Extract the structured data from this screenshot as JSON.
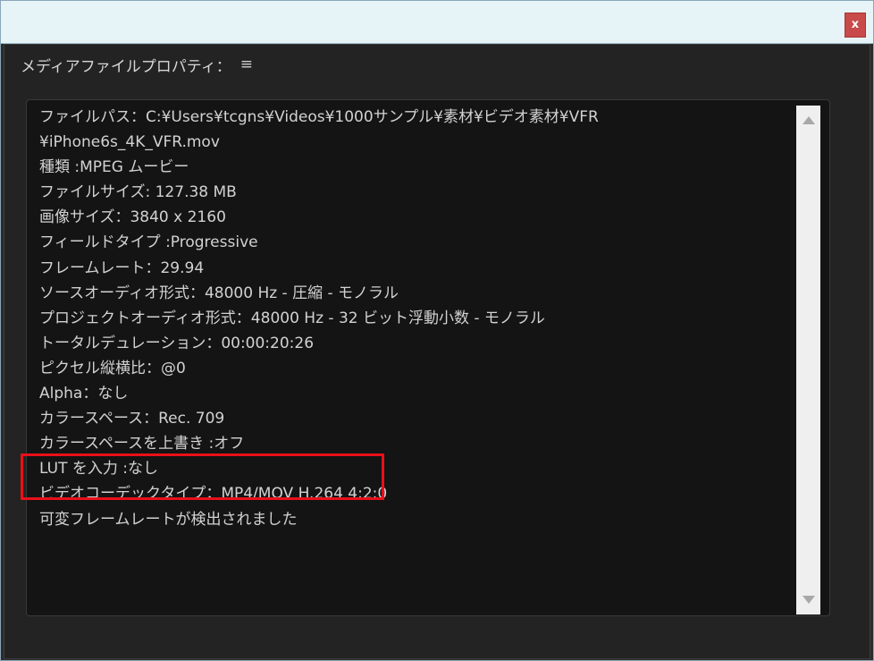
{
  "window": {
    "close_label": "x"
  },
  "panel": {
    "title": "メディアファイルプロパティ：",
    "menu_icon": "hamburger-menu-icon",
    "menu_glyph": "≡"
  },
  "properties": [
    "ファイルパス：C:¥Users¥tcgns¥Videos¥1000サンプル¥素材¥ビデオ素材¥VFR",
    "¥iPhone6s_4K_VFR.mov",
    "種類 :MPEG ムービー",
    "ファイルサイズ: 127.38 MB",
    "画像サイズ：3840 x 2160",
    "フィールドタイプ :Progressive",
    "フレームレート：29.94",
    "ソースオーディオ形式：48000 Hz - 圧縮 - モノラル",
    "プロジェクトオーディオ形式：48000 Hz - 32 ビット浮動小数 - モノラル",
    "トータルデュレーション：00:00:20:26",
    "ピクセル縦横比：@0",
    "Alpha：なし",
    "カラースペース：Rec. 709",
    "カラースペースを上書き :オフ",
    "LUT を入力 :なし",
    "ビデオコーデックタイプ：MP4/MOV H.264 4:2:0",
    "可変フレームレートが検出されました"
  ],
  "highlight": {
    "color": "#e8101a",
    "target_line": "可変フレームレートが検出されました"
  },
  "colors": {
    "titlebar": "#e6f4f8",
    "close_button": "#c94a4a",
    "background": "#232323",
    "text_area": "#141414",
    "text": "#d2d2d2"
  }
}
